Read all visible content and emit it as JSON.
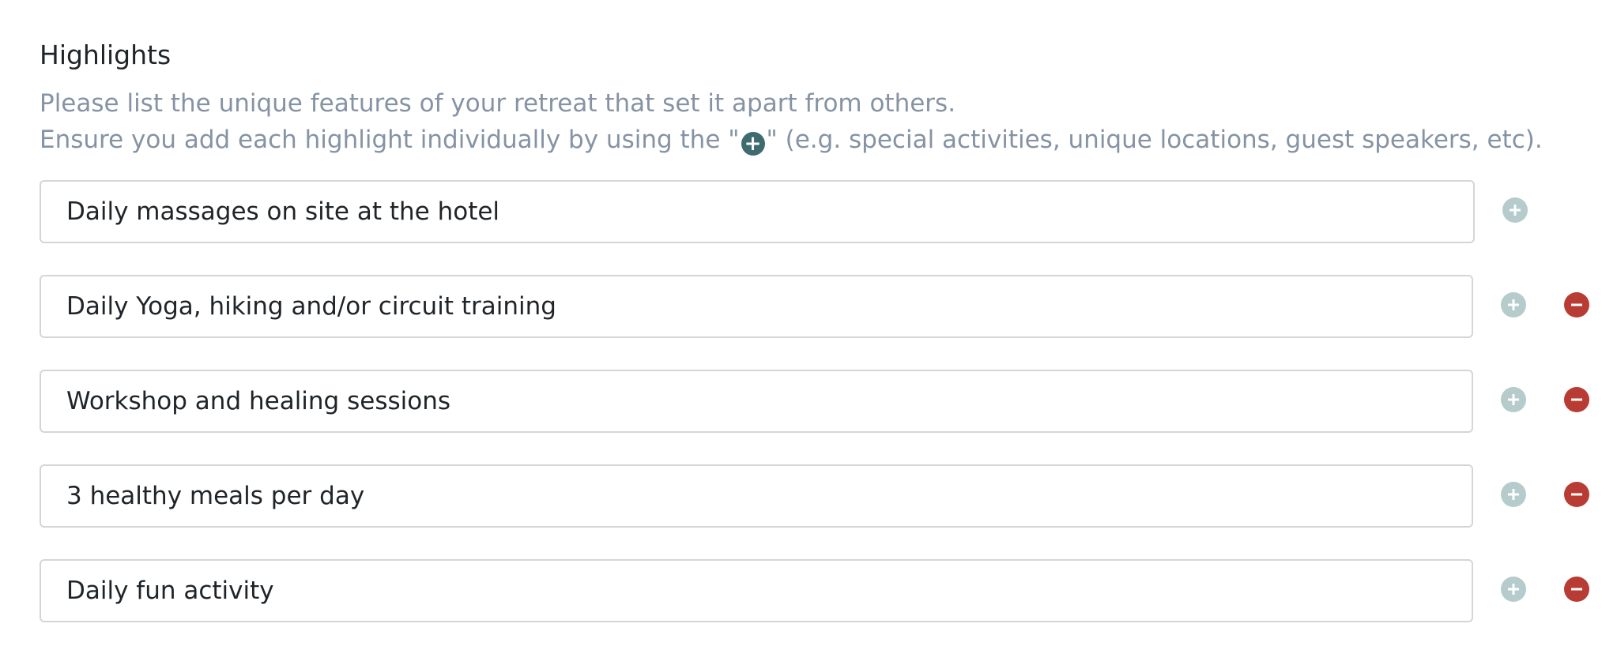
{
  "section": {
    "title": "Highlights",
    "description_line1": "Please list the unique features of your retreat that set it apart from others.",
    "description_line2_prefix": "Ensure you add each highlight individually by using the \"",
    "description_line2_suffix": "\" (e.g. special activities, unique locations, guest speakers, etc)."
  },
  "highlights": [
    {
      "value": "Daily massages on site at the hotel",
      "removable": false
    },
    {
      "value": "Daily Yoga, hiking and/or circuit training",
      "removable": true
    },
    {
      "value": "Workshop and healing sessions",
      "removable": true
    },
    {
      "value": "3 healthy meals per day",
      "removable": true
    },
    {
      "value": "Daily fun activity",
      "removable": true
    }
  ],
  "colors": {
    "add_icon_inline": "#3e6b6e",
    "add_button": "#b6cbcb",
    "remove_button": "#b83c33",
    "muted_text": "#8593a3"
  },
  "icons": {
    "add": "plus-circle-icon",
    "remove": "minus-circle-icon"
  }
}
